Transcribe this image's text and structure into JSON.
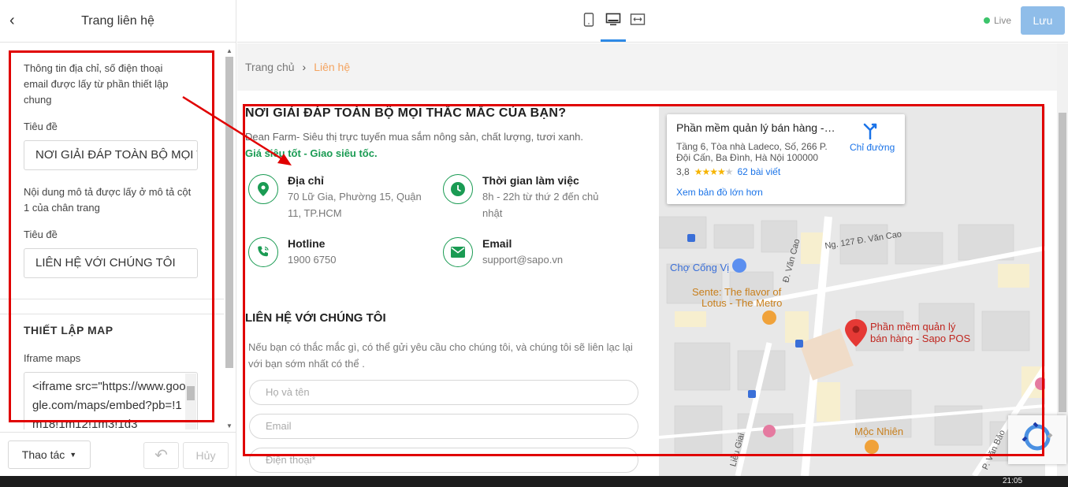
{
  "sidebar": {
    "title": "Trang liên hệ",
    "note1": "Thông tin địa chỉ, số điện thoại email được lấy từ phần thiết lập chung",
    "field1_label": "Tiêu đề",
    "field1_value": "NƠI GIẢI ĐÁP TOÀN BỘ MỌI THẮC MẮC CỦA BẠN?",
    "note2": "Nội dung mô tả được lấy ở mô tả cột 1 của chân trang",
    "field2_label": "Tiêu đề",
    "field2_value": "LIÊN HỆ VỚI CHÚNG TÔI",
    "map_section_title": "THIẾT LẬP MAP",
    "iframe_label": "Iframe maps",
    "iframe_value": "<iframe src=\"https://www.google.com/maps/embed?pb=!1m18!1m12!1m3!1d3"
  },
  "footer": {
    "actions_label": "Thao tác",
    "cancel_label": "Hủy"
  },
  "topbar": {
    "live_label": "Live",
    "save_label": "Lưu"
  },
  "breadcrumb": {
    "home": "Trang chủ",
    "current": "Liên hệ"
  },
  "page": {
    "heading": "NƠI GIẢI ĐÁP TOÀN BỘ MỌI THẮC MẮC CỦA BẠN?",
    "intro": "Dean Farm- Siêu thị trực tuyến mua sắm nông sản, chất lượng, tươi xanh.",
    "slogan": "Giá siêu tốt - Giao siêu tốc.",
    "address_title": "Địa chỉ",
    "address_line1": "70 Lữ Gia, Phường 15, Quận",
    "address_line2": "11, TP.HCM",
    "hours_title": "Thời gian làm việc",
    "hours_line1": "8h - 22h từ thứ 2 đến chủ",
    "hours_line2": "nhật",
    "hotline_title": "Hotline",
    "hotline_value": "1900 6750",
    "email_title": "Email",
    "email_value": "support@sapo.vn",
    "contact_heading": "LIÊN HỆ VỚI CHÚNG TÔI",
    "contact_desc": "Nếu bạn có thắc mắc gì, có thể gửi yêu cầu cho chúng tôi, và chúng tôi sẽ liên lạc lại với bạn sớm nhất có thể .",
    "name_placeholder": "Họ và tên",
    "email_placeholder": "Email",
    "phone_placeholder": "Điện thoại*"
  },
  "map": {
    "place_title": "Phần mềm quản lý bán hàng - Sapo POS",
    "place_address": "Tầng 6, Tòa nhà Ladeco, Số, 266 P. Đội Cấn, Ba Đình, Hà Nội 100000",
    "rating": "3,8",
    "rating_value": 3.8,
    "reviews": "62 bài viết",
    "larger_map": "Xem bản đồ lớn hơn",
    "directions": "Chỉ đường",
    "labels": {
      "cho_cong_vi": "Chợ Cống Vị",
      "sente_1": "Sente: The flavor of",
      "sente_2": "Lotus - The Metro",
      "pin_1": "Phần mềm quản lý",
      "pin_2": "bán hàng - Sapo POS",
      "moc_nhien": "Mộc Nhiên",
      "van_cao": "Đ. Văn Cao",
      "ng127": "Ng. 127 Đ. Văn Cao",
      "lieu_giai": "Liễu Giai",
      "p_van_bao": "P. Văn Bảo"
    }
  },
  "taskbar": {
    "time": "21:05"
  },
  "colors": {
    "accent_green": "#1a9b53",
    "breadcrumb_active": "#f4a460",
    "annotation_red": "#e00000",
    "save_button": "#8fbde9"
  }
}
